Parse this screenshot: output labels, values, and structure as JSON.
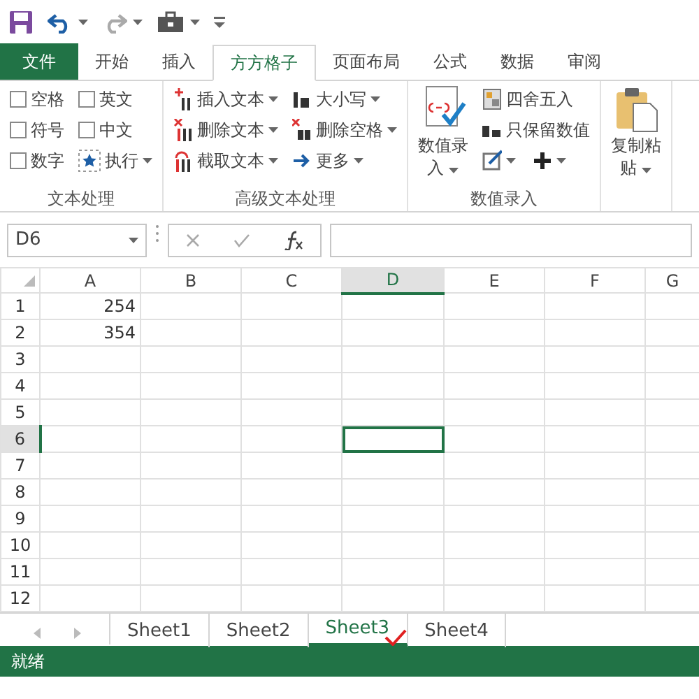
{
  "quick_access": {
    "undo_dropdown": true,
    "redo_dropdown": true,
    "tools_dropdown": true
  },
  "ribbon_tabs": [
    {
      "label": "文件",
      "kind": "file",
      "selected": false
    },
    {
      "label": "开始",
      "kind": "tab",
      "selected": false
    },
    {
      "label": "插入",
      "kind": "tab",
      "selected": false
    },
    {
      "label": "方方格子",
      "kind": "tab",
      "selected": true
    },
    {
      "label": "页面布局",
      "kind": "tab",
      "selected": false
    },
    {
      "label": "公式",
      "kind": "tab",
      "selected": false
    },
    {
      "label": "数据",
      "kind": "tab",
      "selected": false
    },
    {
      "label": "审阅",
      "kind": "tab",
      "selected": false
    }
  ],
  "ribbon_groups": [
    {
      "title": "文本处理",
      "items": [
        {
          "kind": "checkbox",
          "label": "空格",
          "checked": false
        },
        {
          "kind": "checkbox",
          "label": "英文",
          "checked": false
        },
        {
          "kind": "checkbox",
          "label": "符号",
          "checked": false
        },
        {
          "kind": "checkbox",
          "label": "中文",
          "checked": false
        },
        {
          "kind": "checkbox",
          "label": "数字",
          "checked": false
        },
        {
          "kind": "small",
          "label": "执行",
          "dropdown": true
        }
      ]
    },
    {
      "title": "高级文本处理",
      "items": [
        {
          "kind": "small",
          "label": "插入文本",
          "dropdown": true
        },
        {
          "kind": "small",
          "label": "删除文本",
          "dropdown": true
        },
        {
          "kind": "small",
          "label": "截取文本",
          "dropdown": true
        },
        {
          "kind": "small",
          "label": "大小写",
          "dropdown": true
        },
        {
          "kind": "small",
          "label": "删除空格",
          "dropdown": true
        },
        {
          "kind": "small",
          "label": "更多",
          "dropdown": true
        }
      ]
    },
    {
      "title": "数值录入",
      "items": [
        {
          "kind": "large",
          "label_lines": [
            "数值录",
            "入"
          ],
          "dropdown": true
        },
        {
          "kind": "small",
          "label": "四舍五入",
          "dropdown": false
        },
        {
          "kind": "small",
          "label": "只保留数值",
          "dropdown": false
        },
        {
          "kind": "icon",
          "dropdown": true
        },
        {
          "kind": "icon",
          "dropdown": true
        }
      ]
    },
    {
      "items": [
        {
          "kind": "large",
          "label_lines": [
            "复制粘",
            "贴"
          ],
          "dropdown": true
        }
      ]
    }
  ],
  "formula_bar": {
    "name_box": "D6"
  },
  "sheet": {
    "columns": [
      {
        "label": "A",
        "selected": false
      },
      {
        "label": "B",
        "selected": false
      },
      {
        "label": "C",
        "selected": false
      },
      {
        "label": "D",
        "selected": true
      },
      {
        "label": "E",
        "selected": false
      },
      {
        "label": "F",
        "selected": false
      },
      {
        "label": "G",
        "selected": false
      }
    ],
    "rows": [
      {
        "label": "1",
        "selected": false,
        "cells": [
          "254"
        ]
      },
      {
        "label": "2",
        "selected": false,
        "cells": [
          "354"
        ]
      },
      {
        "label": "3",
        "selected": false,
        "cells": []
      },
      {
        "label": "4",
        "selected": false,
        "cells": []
      },
      {
        "label": "5",
        "selected": false,
        "cells": []
      },
      {
        "label": "6",
        "selected": true,
        "cells": []
      },
      {
        "label": "7",
        "selected": false,
        "cells": []
      },
      {
        "label": "8",
        "selected": false,
        "cells": []
      },
      {
        "label": "9",
        "selected": false,
        "cells": []
      },
      {
        "label": "10",
        "selected": false,
        "cells": []
      },
      {
        "label": "11",
        "selected": false,
        "cells": []
      },
      {
        "label": "12",
        "selected": false,
        "cells": []
      }
    ]
  },
  "sheet_tabs": [
    {
      "label": "Sheet1",
      "selected": false
    },
    {
      "label": "Sheet2",
      "selected": false
    },
    {
      "label": "Sheet3",
      "selected": true
    },
    {
      "label": "Sheet4",
      "selected": false
    }
  ],
  "status_bar": {
    "text": "就绪"
  }
}
